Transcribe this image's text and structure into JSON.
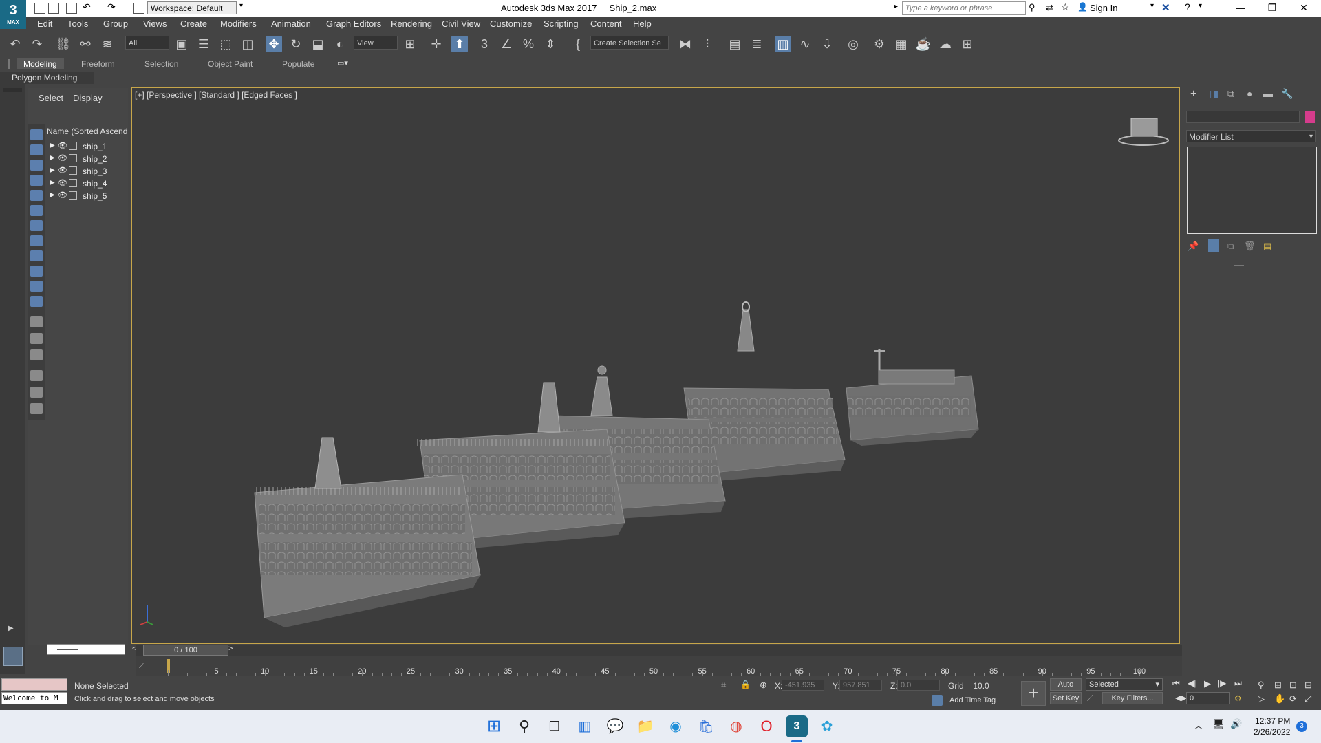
{
  "titlebar": {
    "logo_text": "3",
    "logo_sub": "MAX",
    "workspace": "Workspace: Default",
    "app_title": "Autodesk 3ds Max 2017",
    "file_name": "Ship_2.max",
    "search_placeholder": "Type a keyword or phrase",
    "sign_in": "Sign In"
  },
  "menu": [
    "Edit",
    "Tools",
    "Group",
    "Views",
    "Create",
    "Modifiers",
    "Animation",
    "Graph Editors",
    "Rendering",
    "Civil View",
    "Customize",
    "Scripting",
    "Content",
    "Help"
  ],
  "toolbar": {
    "filter_all": "All",
    "ref_coord": "View",
    "selection_set": "Create Selection Se"
  },
  "ribbon": {
    "tabs": [
      "Modeling",
      "Freeform",
      "Selection",
      "Object Paint",
      "Populate"
    ],
    "active": "Modeling",
    "panel_label": "Polygon Modeling"
  },
  "explorer": {
    "tabs": [
      "Select",
      "Display"
    ],
    "column_header": "Name (Sorted Ascending)",
    "objects": [
      "ship_1",
      "ship_2",
      "ship_3",
      "ship_4",
      "ship_5"
    ]
  },
  "viewport": {
    "label": "[+] [Perspective ] [Standard ] [Edged Faces ]"
  },
  "command_panel": {
    "modifier_list": "Modifier List"
  },
  "timeline": {
    "frame_counter": "0 / 100",
    "ticks": [
      "5",
      "10",
      "15",
      "20",
      "25",
      "30",
      "35",
      "40",
      "45",
      "50",
      "55",
      "60",
      "65",
      "70",
      "75",
      "80",
      "85",
      "90",
      "95",
      "100"
    ]
  },
  "status": {
    "listener_text": "Welcome to M",
    "selection": "None Selected",
    "prompt": "Click and drag to select and move objects",
    "x_label": "X:",
    "x_value": "-451.935",
    "y_label": "Y:",
    "y_value": "957.851",
    "z_label": "Z:",
    "z_value": "0.0",
    "grid": "Grid = 10.0",
    "add_time_tag": "Add Time Tag",
    "auto_key": "Auto Key",
    "set_key": "Set Key",
    "key_mode": "Selected",
    "key_filters": "Key Filters...",
    "current_frame": "0"
  },
  "taskbar": {
    "time": "12:37 PM",
    "date": "2/26/2022",
    "notifications": "3"
  },
  "colors": {
    "viewport_border": "#c7a64a",
    "accent": "#5a7ea8",
    "object_color": "#d53c8c"
  }
}
